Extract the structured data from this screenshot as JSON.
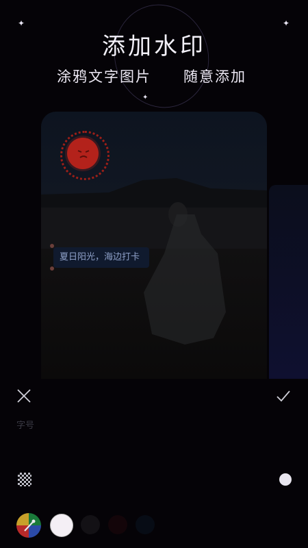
{
  "header": {
    "title": "添加水印",
    "subtitle_left": "涂鸦文字图片",
    "subtitle_right": "随意添加"
  },
  "canvas": {
    "sticker_text": "夏日阳光，海边打卡",
    "sun_sticker_icon": "sun-face-icon"
  },
  "toolbar": {
    "close_icon": "close-icon",
    "confirm_icon": "check-icon",
    "size_label": "字号"
  },
  "brush_options": {
    "mosaic_icon": "mosaic-icon",
    "size_indicator": "size-dot"
  },
  "colors": {
    "selected": "#f4eff5",
    "palette_icon": "color-palette-icon"
  }
}
